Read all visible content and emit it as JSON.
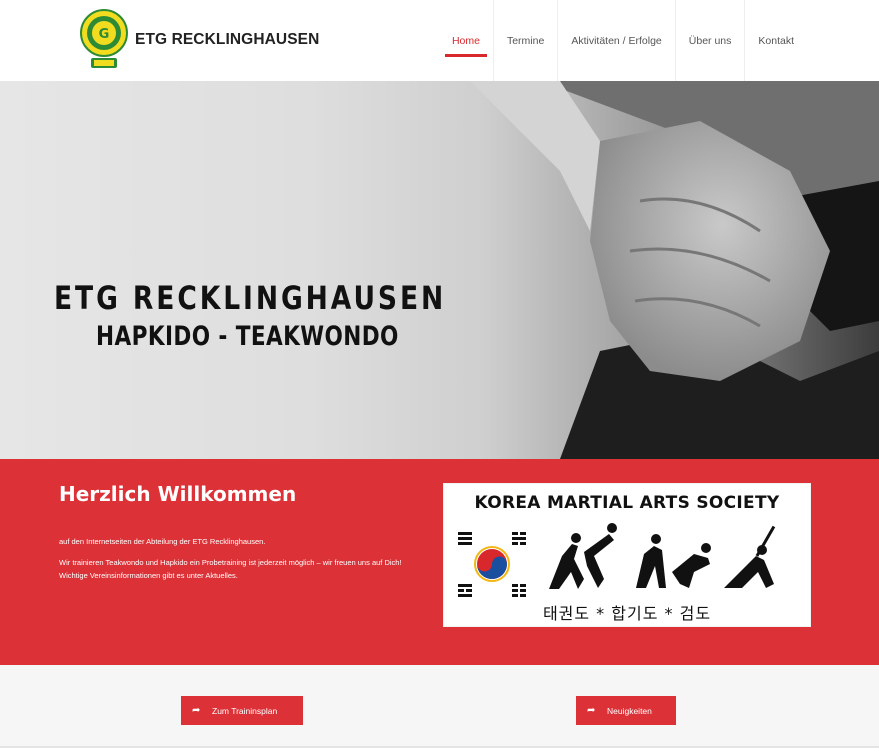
{
  "header": {
    "brand": "ETG RECKLINGHAUSEN",
    "nav": [
      "Home",
      "Termine",
      "Aktivitäten / Erfolge",
      "Über uns",
      "Kontakt"
    ],
    "active_index": 0
  },
  "hero": {
    "title": "ETG RECKLINGHAUSEN",
    "subtitle": "HAPKIDO - TEAKWONDO"
  },
  "welcome": {
    "title": "Herzlich Willkommen",
    "paragraph1": "auf den Internetseiten der Abteilung der ETG Recklinghausen.",
    "paragraph2": "Wir trainieren Teakwondo und Hapkido ein Probetraining ist jederzeit möglich – wir freuen uns auf Dich! Wichtige Vereinsinformationen gibt es unter Aktuelles.",
    "image": {
      "title": "KOREA MARTIAL ARTS SOCIETY",
      "korean": "태권도 * 합기도 * 검도"
    }
  },
  "actions": {
    "training_button": "Zum Traininsplan",
    "news_button": "Neuigkeiten",
    "button_icon": "share-arrow-icon"
  },
  "colors": {
    "accent": "#dc3237",
    "logo_green": "#2e8b35",
    "logo_yellow": "#f2dc1f"
  }
}
